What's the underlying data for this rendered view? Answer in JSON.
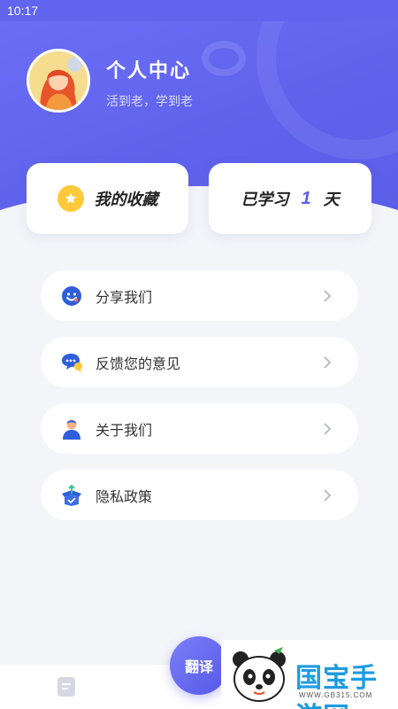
{
  "status": {
    "time": "10:17"
  },
  "profile": {
    "title": "个人中心",
    "subtitle": "活到老，学到老"
  },
  "favorites": {
    "label": "我的收藏"
  },
  "study": {
    "prefix": "已学习",
    "days": "1",
    "suffix": "天"
  },
  "menu": {
    "items": [
      {
        "label": "分享我们",
        "icon": "smile-face-icon"
      },
      {
        "label": "反馈您的意见",
        "icon": "chat-bubble-icon"
      },
      {
        "label": "关于我们",
        "icon": "person-icon"
      },
      {
        "label": "隐私政策",
        "icon": "shield-box-icon"
      }
    ]
  },
  "tabbar": {
    "translate_label": "翻译"
  },
  "watermark": {
    "brand": "国宝手游网",
    "url": "WWW.GB315.COM"
  },
  "colors": {
    "primary": "#5f62ec",
    "star": "#ffc93a",
    "background": "#f4f5f9"
  }
}
